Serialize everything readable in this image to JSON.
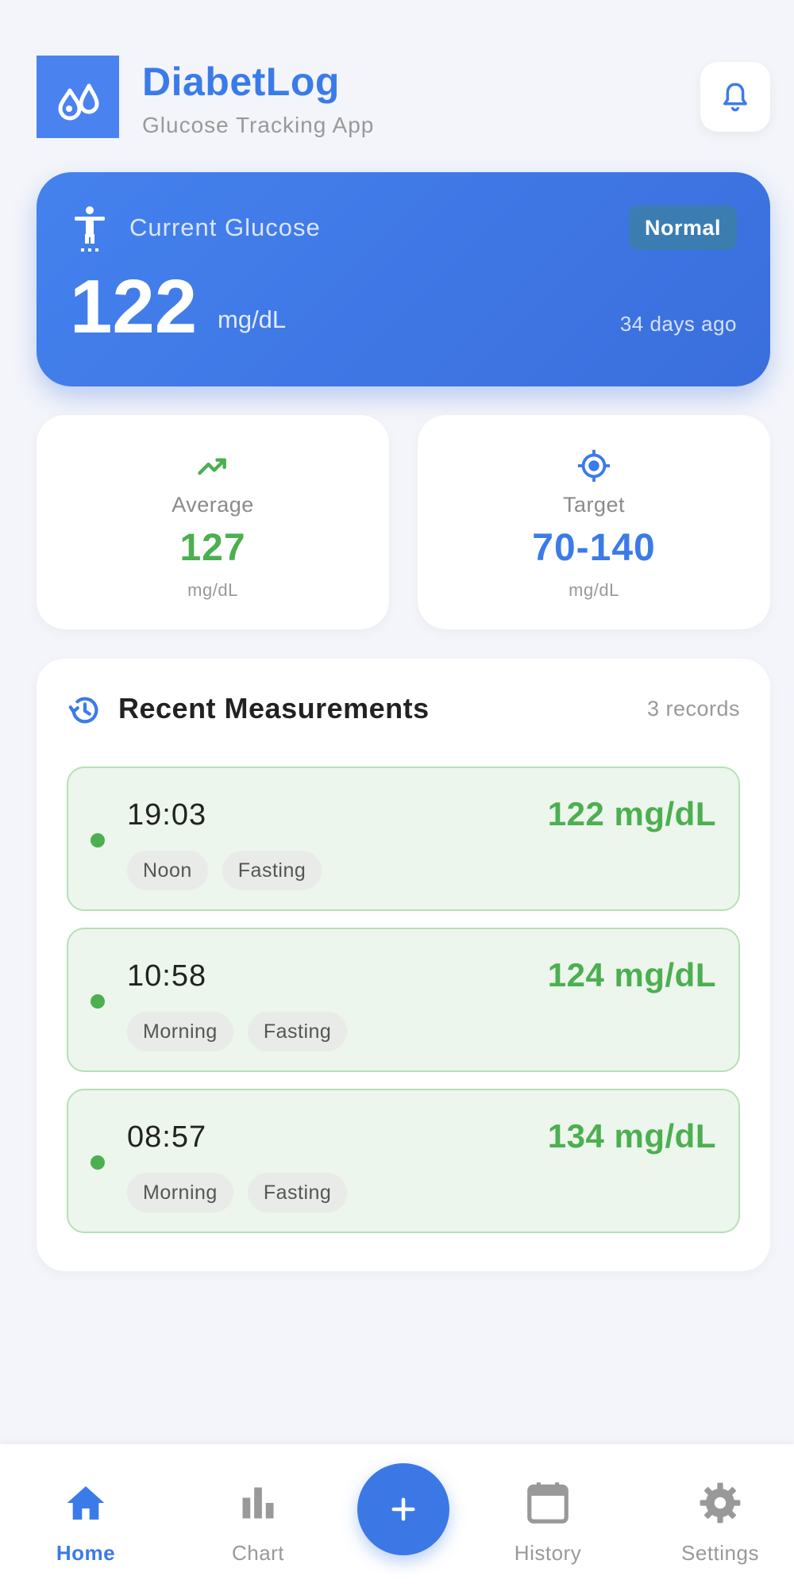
{
  "header": {
    "title": "DiabetLog",
    "subtitle": "Glucose Tracking App",
    "logo_icon": "water-drops-icon",
    "notification_icon": "bell-icon"
  },
  "current_glucose": {
    "label": "Current Glucose",
    "status": "Normal",
    "value": "122",
    "unit": "mg/dL",
    "time_ago": "34 days ago",
    "icon": "accessibility-icon"
  },
  "stats": {
    "average": {
      "label": "Average",
      "value": "127",
      "unit": "mg/dL",
      "icon": "trending-up-icon"
    },
    "target": {
      "label": "Target",
      "value": "70-140",
      "unit": "mg/dL",
      "icon": "target-icon"
    }
  },
  "recent": {
    "title": "Recent Measurements",
    "count": "3 records",
    "icon": "history-icon",
    "items": [
      {
        "time": "19:03",
        "value": "122 mg/dL",
        "tags": [
          "Noon",
          "Fasting"
        ]
      },
      {
        "time": "10:58",
        "value": "124 mg/dL",
        "tags": [
          "Morning",
          "Fasting"
        ]
      },
      {
        "time": "08:57",
        "value": "134 mg/dL",
        "tags": [
          "Morning",
          "Fasting"
        ]
      }
    ]
  },
  "nav": {
    "items": [
      {
        "label": "Home",
        "icon": "home-icon",
        "active": true
      },
      {
        "label": "Chart",
        "icon": "bar-chart-icon",
        "active": false
      },
      {
        "label": "History",
        "icon": "calendar-icon",
        "active": false
      },
      {
        "label": "Settings",
        "icon": "gear-icon",
        "active": false
      }
    ],
    "fab_icon": "plus-icon"
  },
  "colors": {
    "primary": "#3b7be8",
    "success": "#4caf50",
    "background": "#f3f5fa"
  }
}
